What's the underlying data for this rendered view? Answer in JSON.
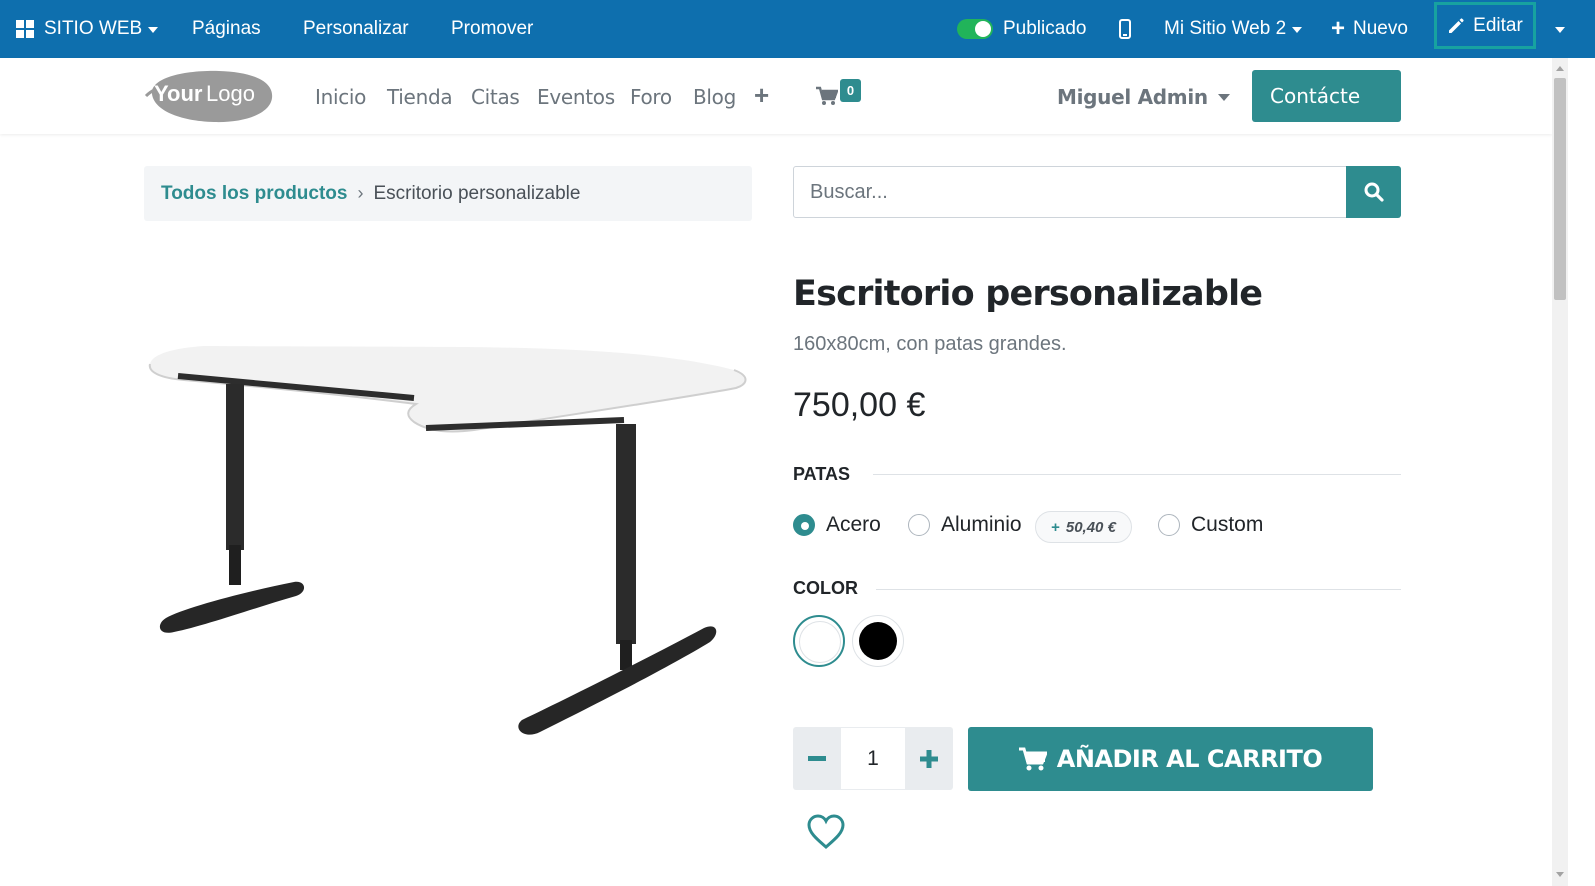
{
  "admin_bar": {
    "website_menu": "SITIO WEB",
    "pages": "Páginas",
    "customize": "Personalizar",
    "promote": "Promover",
    "published": "Publicado",
    "site_selector": "Mi Sitio Web 2",
    "new": "Nuevo",
    "edit": "Editar"
  },
  "navbar": {
    "logo_text": "YourLogo",
    "links": [
      "Inicio",
      "Tienda",
      "Citas",
      "Eventos",
      "Foro",
      "Blog"
    ],
    "cart_count": "0",
    "user_name": "Miguel Admin",
    "contact_button": "Contácte"
  },
  "breadcrumb": {
    "parent": "Todos los productos",
    "current": "Escritorio personalizable"
  },
  "search": {
    "placeholder": "Buscar..."
  },
  "product": {
    "name": "Escritorio personalizable",
    "description": "160x80cm, con patas grandes.",
    "price": "750,00 €",
    "attributes": {
      "legs": {
        "label": "PATAS",
        "options": [
          {
            "label": "Acero",
            "selected": true
          },
          {
            "label": "Aluminio",
            "selected": false,
            "extra": "50,40 €",
            "extra_sign": "+"
          },
          {
            "label": "Custom",
            "selected": false
          }
        ]
      },
      "color": {
        "label": "COLOR",
        "swatches": [
          {
            "name": "white",
            "hex": "#ffffff",
            "selected": true
          },
          {
            "name": "black",
            "hex": "#000000",
            "selected": false
          }
        ]
      }
    },
    "quantity": "1",
    "add_to_cart": "AÑADIR AL CARRITO"
  },
  "colors": {
    "admin_bar": "#0e6fae",
    "primary": "#2e8c8f",
    "published_toggle": "#21b45a"
  }
}
